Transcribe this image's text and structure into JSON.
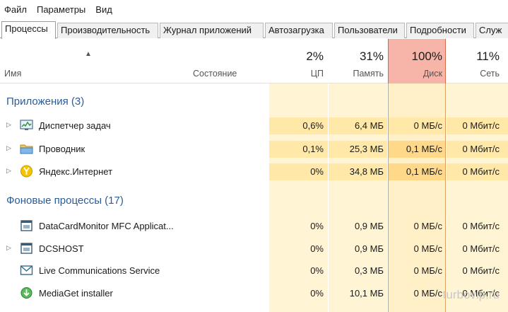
{
  "menu": [
    "Файл",
    "Параметры",
    "Вид"
  ],
  "tabs": [
    "Процессы",
    "Производительность",
    "Журнал приложений",
    "Автозагрузка",
    "Пользователи",
    "Подробности",
    "Служ"
  ],
  "header": {
    "name": "Имя",
    "status": "Состояние",
    "cpu": {
      "pct": "2%",
      "label": "ЦП"
    },
    "memory": {
      "pct": "31%",
      "label": "Память"
    },
    "disk": {
      "pct": "100%",
      "label": "Диск"
    },
    "network": {
      "pct": "11%",
      "label": "Сеть"
    }
  },
  "groups": {
    "apps": "Приложения (3)",
    "background": "Фоновые процессы (17)"
  },
  "apps": [
    {
      "name": "Диспетчер задач",
      "cpu": "0,6%",
      "memory": "6,4 МБ",
      "disk": "0 МБ/с",
      "network": "0 Мбит/с",
      "icon": "task-manager-icon"
    },
    {
      "name": "Проводник",
      "cpu": "0,1%",
      "memory": "25,3 МБ",
      "disk": "0,1 МБ/с",
      "network": "0 Мбит/с",
      "icon": "explorer-icon"
    },
    {
      "name": "Яндекс.Интернет",
      "cpu": "0%",
      "memory": "34,8 МБ",
      "disk": "0,1 МБ/с",
      "network": "0 Мбит/с",
      "icon": "yandex-icon"
    }
  ],
  "background": [
    {
      "name": "DataCardMonitor MFC Applicat...",
      "cpu": "0%",
      "memory": "0,9 МБ",
      "disk": "0 МБ/с",
      "network": "0 Мбит/с",
      "icon": "app-window-icon"
    },
    {
      "name": "DCSHOST",
      "cpu": "0%",
      "memory": "0,9 МБ",
      "disk": "0 МБ/с",
      "network": "0 Мбит/с",
      "icon": "app-window-icon"
    },
    {
      "name": "Live Communications Service",
      "cpu": "0%",
      "memory": "0,3 МБ",
      "disk": "0 МБ/с",
      "network": "0 Мбит/с",
      "icon": "mail-icon"
    },
    {
      "name": "MediaGet installer",
      "cpu": "0%",
      "memory": "10,1 МБ",
      "disk": "0 МБ/с",
      "network": "0 Мбит/с",
      "icon": "mediaget-icon"
    }
  ],
  "watermark": "turbovip.ru",
  "colors": {
    "group_text": "#2a5c9a",
    "disk_header": "#f6b5a8",
    "heat_light": "#fff4d4",
    "heat_mid": "#ffe8a8",
    "heat_high": "#ffd88a"
  }
}
